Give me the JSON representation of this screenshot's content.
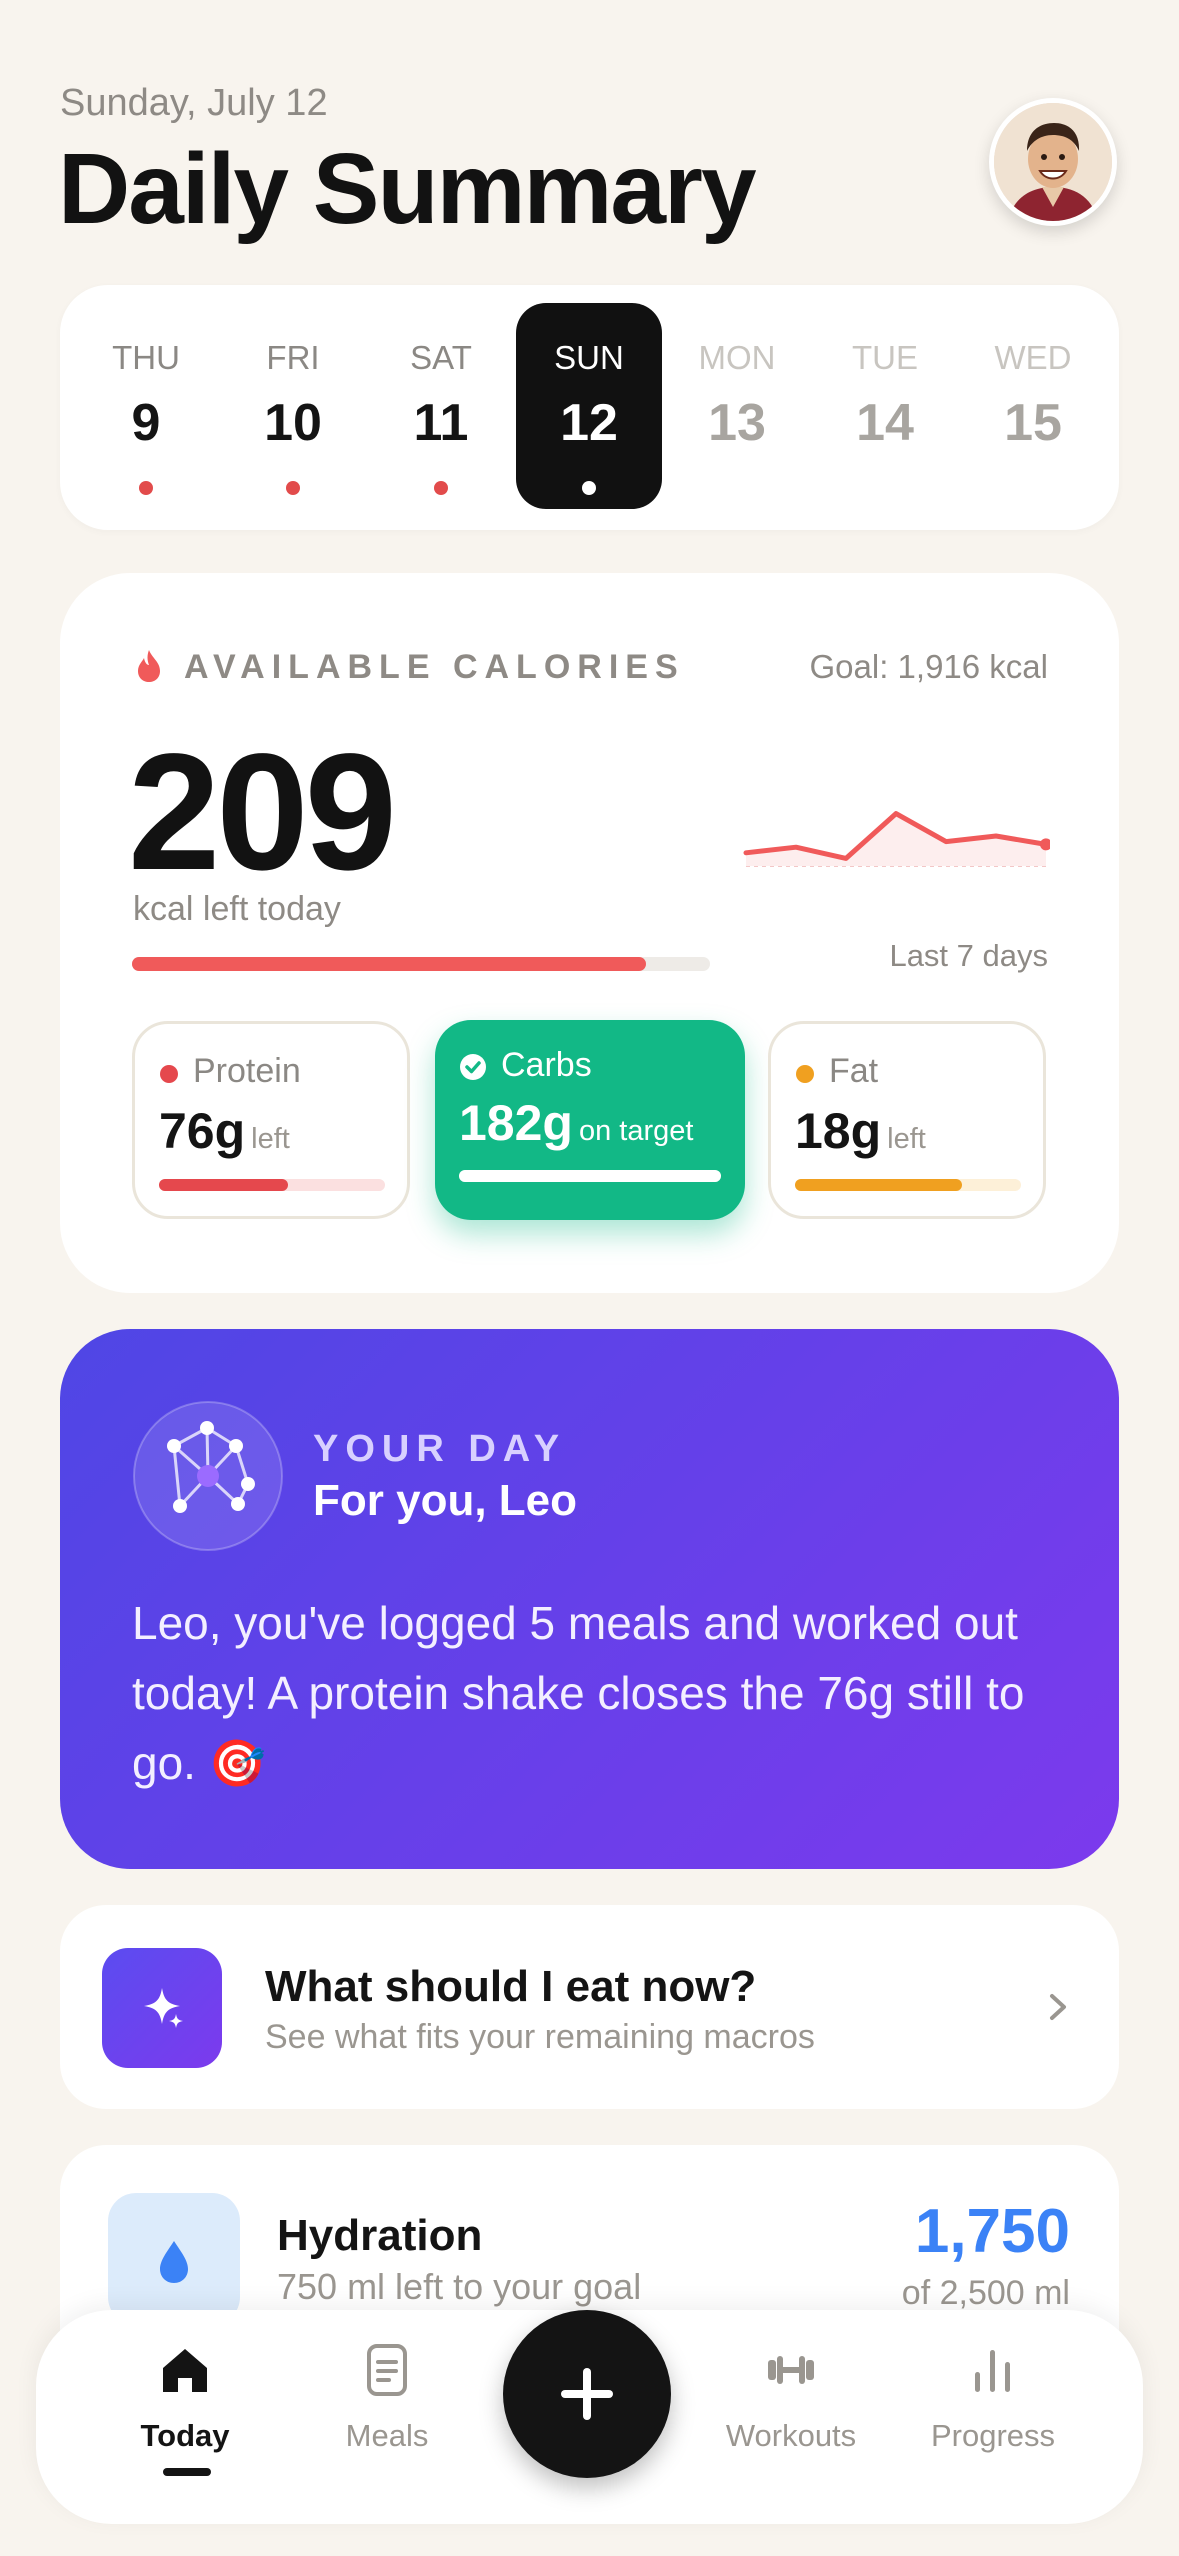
{
  "header": {
    "date": "Sunday, July 12",
    "title": "Daily Summary"
  },
  "week": [
    {
      "name": "THU",
      "num": "9",
      "state": "logged"
    },
    {
      "name": "FRI",
      "num": "10",
      "state": "logged"
    },
    {
      "name": "SAT",
      "num": "11",
      "state": "logged"
    },
    {
      "name": "SUN",
      "num": "12",
      "state": "active"
    },
    {
      "name": "MON",
      "num": "13",
      "state": "future"
    },
    {
      "name": "TUE",
      "num": "14",
      "state": "future"
    },
    {
      "name": "WED",
      "num": "15",
      "state": "future"
    }
  ],
  "calories": {
    "label": "AVAILABLE CALORIES",
    "goal": "Goal: 1,916 kcal",
    "remaining": "209",
    "remaining_caption": "kcal left today",
    "consumed_fraction": 0.89,
    "trend_caption": "Last 7 days",
    "trend_values": [
      1840,
      1860,
      1820,
      1980,
      1880,
      1900,
      1870
    ]
  },
  "macros": {
    "protein": {
      "name": "Protein",
      "value": "76g",
      "unit": "left",
      "fraction": 0.57,
      "color": "#E5484D"
    },
    "carbs": {
      "name": "Carbs",
      "value": "182g",
      "unit": "on target",
      "fraction": 1.0,
      "color": "#12B886"
    },
    "fat": {
      "name": "Fat",
      "value": "18g",
      "unit": "left",
      "fraction": 0.74,
      "color": "#F0A020"
    }
  },
  "insight": {
    "eyebrow": "YOUR DAY",
    "title": "For you, Leo",
    "text": "Leo, you've logged 5 meals and worked out today! A protein shake closes the 76g still to go. 🎯"
  },
  "suggestion": {
    "title": "What should I eat now?",
    "subtitle": "See what fits your remaining macros"
  },
  "hydration": {
    "title": "Hydration",
    "subtitle": "750 ml left to your goal",
    "value": "1,750",
    "of": "of 2,500 ml"
  },
  "tabs": [
    {
      "label": "Today",
      "icon": "home-icon"
    },
    {
      "label": "Meals",
      "icon": "document-icon"
    },
    {
      "label": "Workouts",
      "icon": "dumbbell-icon"
    },
    {
      "label": "Progress",
      "icon": "bar-chart-icon"
    }
  ],
  "colors": {
    "accent_red": "#F05A5A",
    "accent_green": "#12B886",
    "accent_purple": "#6D3FEA",
    "accent_blue": "#3B82F6"
  }
}
